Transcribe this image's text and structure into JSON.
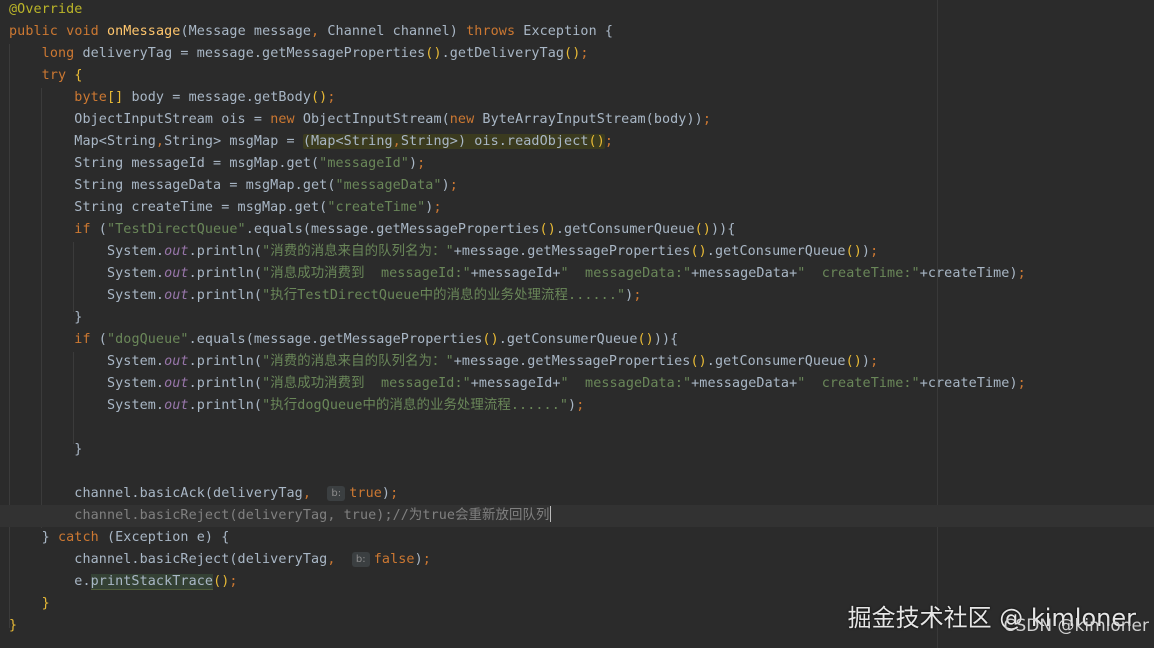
{
  "editor": {
    "lines": {
      "l1": {
        "annotation": "@Override"
      },
      "l2": {
        "mod1": "public",
        "void": "void",
        "name": "onMessage",
        "params_a": "(Message message",
        "comma": ",",
        "params_b": " Channel channel) ",
        "throws": "throws",
        "exc": " Exception {"
      },
      "l3": {
        "type": "long",
        "rest_a": " deliveryTag = message.getMessageProperties",
        "paren1": "()",
        "rest_b": ".getDeliveryTag",
        "paren2": "()",
        "semi": ";"
      },
      "l4": {
        "try": "try",
        "brace": " {"
      },
      "l5": {
        "type": "byte",
        "arr": "[]",
        "rest_a": " body = message.getBody",
        "paren": "()",
        "semi": ";"
      },
      "l6": {
        "pre": "ObjectInputStream ois = ",
        "new1": "new",
        "mid": " ObjectInputStream(",
        "new2": "new",
        "post": " ByteArrayInputStream(body))",
        "semi": ";"
      },
      "l7": {
        "pre": "Map<String",
        "c1": ",",
        "mid": "String> msgMap = ",
        "cast_a": "(Map<String",
        "c2": ",",
        "cast_b": "String>)",
        "ro": " ois.readObject",
        "ro_paren": "()",
        "semi": ";"
      },
      "l8": {
        "pre": "String messageId = msgMap.get(",
        "str": "\"messageId\"",
        "post": ")",
        "semi": ";"
      },
      "l9": {
        "pre": "String messageData = msgMap.get(",
        "str": "\"messageData\"",
        "post": ")",
        "semi": ";"
      },
      "l10": {
        "pre": "String createTime = msgMap.get(",
        "str": "\"createTime\"",
        "post": ")",
        "semi": ";"
      },
      "l11": {
        "if": "if",
        "open": " (",
        "str": "\"TestDirectQueue\"",
        "mid": ".equals(message.getMessageProperties",
        "p1": "()",
        "mid2": ".getConsumerQueue",
        "p2": "()",
        "close": ")){"
      },
      "l12": {
        "sys": "System.",
        "out": "out",
        "pr": ".println(",
        "str": "\"消费的消息来自的队列名为：\"",
        "post": "+message.getMessageProperties",
        "p1": "()",
        "post2": ".getConsumerQueue",
        "p2": "()",
        "end": ")",
        "semi": ";"
      },
      "l13": {
        "sys": "System.",
        "out": "out",
        "pr": ".println(",
        "s1": "\"消息成功消费到  messageId:\"",
        "v1": "+messageId+",
        "s2": "\"  messageData:\"",
        "v2": "+messageData+",
        "s3": "\"  createTime:\"",
        "v3": "+createTime)",
        "semi": ";"
      },
      "l14": {
        "sys": "System.",
        "out": "out",
        "pr": ".println(",
        "str": "\"执行TestDirectQueue中的消息的业务处理流程......\"",
        "end": ")",
        "semi": ";"
      },
      "l15": {
        "brace": "}"
      },
      "l16": {
        "if": "if",
        "open": " (",
        "str": "\"dogQueue\"",
        "mid": ".equals(message.getMessageProperties",
        "p1": "()",
        "mid2": ".getConsumerQueue",
        "p2": "()",
        "close": ")){"
      },
      "l17": {
        "sys": "System.",
        "out": "out",
        "pr": ".println(",
        "str": "\"消费的消息来自的队列名为：\"",
        "post": "+message.getMessageProperties",
        "p1": "()",
        "post2": ".getConsumerQueue",
        "p2": "()",
        "end": ")",
        "semi": ";"
      },
      "l18": {
        "sys": "System.",
        "out": "out",
        "pr": ".println(",
        "s1": "\"消息成功消费到  messageId:\"",
        "v1": "+messageId+",
        "s2": "\"  messageData:\"",
        "v2": "+messageData+",
        "s3": "\"  createTime:\"",
        "v3": "+createTime)",
        "semi": ";"
      },
      "l19": {
        "sys": "System.",
        "out": "out",
        "pr": ".println(",
        "str": "\"执行dogQueue中的消息的业务处理流程......\"",
        "end": ")",
        "semi": ";"
      },
      "l21": {
        "brace": "}"
      },
      "l23": {
        "pre": "channel.basicAck(deliveryTag",
        "comma": ",",
        "hint": "b:",
        "val": "true",
        "end": ")",
        "semi": ";"
      },
      "l24": {
        "text": "channel.basicReject(deliveryTag, true);//为true会重新放回队列"
      },
      "l25": {
        "close": "} ",
        "catch": "catch",
        "rest": " (Exception e) {"
      },
      "l26": {
        "pre": "channel.basicReject(deliveryTag",
        "comma": ",",
        "hint": "b:",
        "val": "false",
        "end": ")",
        "semi": ";"
      },
      "l27": {
        "pre": "e.",
        "call": "printStackTrace",
        "paren": "()",
        "semi": ";"
      },
      "l28": {
        "brace": "}"
      },
      "l29": {
        "brace": "}"
      }
    }
  },
  "watermark": {
    "main": "掘金技术社区 @ kimloner",
    "csdn": "CSDN @kimloner"
  }
}
